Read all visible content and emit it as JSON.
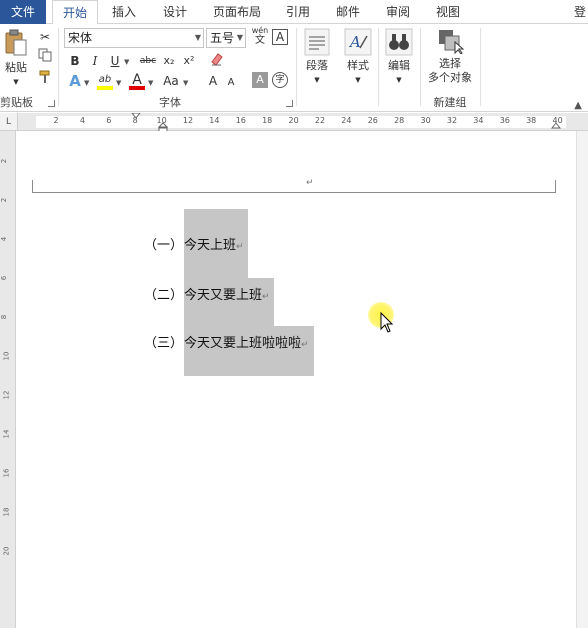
{
  "tabs": {
    "file": "文件",
    "home": "开始",
    "insert": "插入",
    "design": "设计",
    "layout": "页面布局",
    "references": "引用",
    "mailings": "邮件",
    "review": "审阅",
    "view": "视图",
    "login": "登录"
  },
  "ribbon": {
    "clipboard": {
      "paste_label": "粘贴",
      "group_label": "剪贴板"
    },
    "font": {
      "font_name": "宋体",
      "font_size": "五号",
      "wen_char": "wén",
      "wen_sub": "文",
      "a_box": "A",
      "bold": "B",
      "italic": "I",
      "underline": "U",
      "strike": "abc",
      "subscript": "x₂",
      "superscript": "x²",
      "text_effects": "A",
      "highlight": "ab",
      "font_color": "A",
      "change_case": "Aa",
      "grow": "A",
      "shrink": "A",
      "char_shading": "A",
      "enclose": "字",
      "group_label": "字体"
    },
    "paragraph_label": "段落",
    "styles_label": "样式",
    "editing_label": "编辑",
    "select_multi_line1": "选择",
    "select_multi_line2": "多个对象",
    "new_group_label": "新建组"
  },
  "ruler": {
    "ticks": [
      "2",
      "4",
      "6",
      "8",
      "10",
      "12",
      "14",
      "16",
      "18",
      "20",
      "22",
      "24",
      "26",
      "28",
      "30",
      "32",
      "34",
      "36",
      "38",
      "40"
    ],
    "vticks": [
      "2",
      "2",
      "4",
      "6",
      "8",
      "10",
      "12",
      "14",
      "16",
      "18",
      "20"
    ]
  },
  "document": {
    "items": [
      {
        "number": "（一）",
        "text": "今天上班"
      },
      {
        "number": "（二）",
        "text": "今天又要上班"
      },
      {
        "number": "（三）",
        "text": "今天又要上班啦啦啦"
      }
    ],
    "para_mark": "↵"
  },
  "colors": {
    "file_tab": "#2b579a",
    "selection": "#c6c6c6",
    "cursor_highlight": "#fff23c"
  }
}
